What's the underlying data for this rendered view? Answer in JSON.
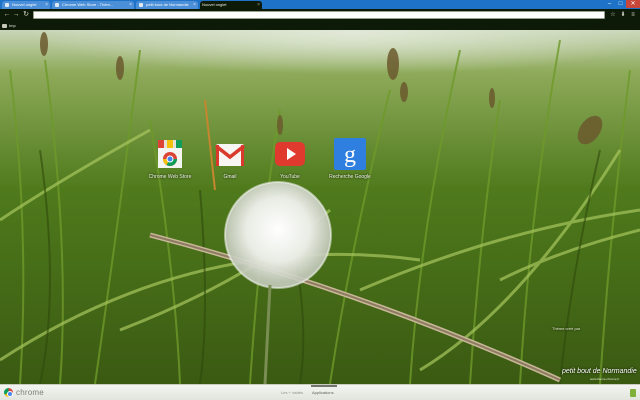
{
  "tabs": [
    {
      "title": "Nouvel onglet",
      "active": false
    },
    {
      "title": "Chrome Web Store - Thèm...",
      "active": false
    },
    {
      "title": "petit bout de Normandie",
      "active": false
    },
    {
      "title": "Nouvel onglet",
      "active": true
    }
  ],
  "toolbar": {
    "back": "←",
    "forward": "→",
    "reload": "↻",
    "address_value": "",
    "star": "☆",
    "menu": "≡"
  },
  "window_controls": {
    "minimize": "–",
    "maximize": "□",
    "close": "✕"
  },
  "bookmarks": [
    {
      "label": "Imp"
    }
  ],
  "apps": [
    {
      "label": "Chrome Web Store",
      "icon": "chrome-web-store-icon"
    },
    {
      "label": "Gmail",
      "icon": "gmail-icon"
    },
    {
      "label": "YouTube",
      "icon": "youtube-icon"
    },
    {
      "label": "Recherche Google",
      "icon": "google-search-icon"
    }
  ],
  "theme": {
    "credit": "Thème créé par",
    "signature": "petit bout de Normandie",
    "signature_sub": "www.theme-chrome.fr"
  },
  "footer": {
    "brand": "chrome",
    "links": [
      {
        "label": "Les + visités",
        "active": false
      },
      {
        "label": "Applications",
        "active": true
      }
    ]
  },
  "colors": {
    "tabstrip": "#1e73c9",
    "frame": "#0e1a08",
    "grass": "#4f7a1c",
    "youtube": "#e03a2f",
    "google": "#2f7fe0",
    "gmail": "#d93a2c"
  }
}
